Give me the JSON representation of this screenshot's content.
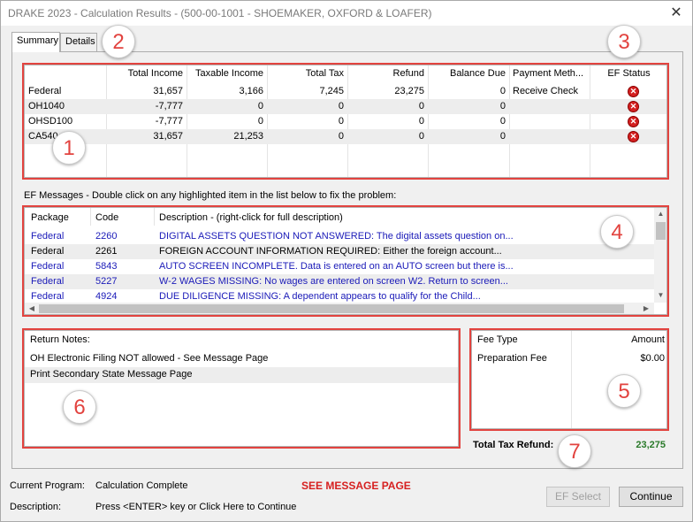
{
  "window": {
    "title": "DRAKE 2023 - Calculation Results - (500-00-1001 - SHOEMAKER, OXFORD & LOAFER)",
    "close_glyph": "✕"
  },
  "tabs": [
    {
      "label": "Summary",
      "active": true
    },
    {
      "label": "Details",
      "active": false
    }
  ],
  "summary": {
    "columns": [
      "",
      "Total Income",
      "Taxable Income",
      "Total Tax",
      "Refund",
      "Balance Due",
      "Payment Meth...",
      "EF Status"
    ],
    "rows": [
      {
        "name": "Federal",
        "total_income": "31,657",
        "taxable_income": "3,166",
        "total_tax": "7,245",
        "refund": "23,275",
        "balance_due": "0",
        "payment": "Receive Check",
        "ef_status": "error-icon"
      },
      {
        "name": "OH1040",
        "total_income": "-7,777",
        "taxable_income": "0",
        "total_tax": "0",
        "refund": "0",
        "balance_due": "0",
        "payment": "",
        "ef_status": "error-icon"
      },
      {
        "name": "OHSD100",
        "total_income": "-7,777",
        "taxable_income": "0",
        "total_tax": "0",
        "refund": "0",
        "balance_due": "0",
        "payment": "",
        "ef_status": "error-icon"
      },
      {
        "name": "CA540",
        "total_income": "31,657",
        "taxable_income": "21,253",
        "total_tax": "0",
        "refund": "0",
        "balance_due": "0",
        "payment": "",
        "ef_status": "error-icon"
      }
    ]
  },
  "ef_messages": {
    "heading": "EF Messages - Double click on any highlighted item in the list below to fix the problem:",
    "columns": [
      "Package",
      "Code",
      "Description - (right-click for full description)"
    ],
    "rows": [
      {
        "package": "Federal",
        "code": "2260",
        "description": "DIGITAL ASSETS QUESTION NOT ANSWERED: The digital assets question on...",
        "highlighted": true
      },
      {
        "package": "Federal",
        "code": "2261",
        "description": "FOREIGN ACCOUNT INFORMATION REQUIRED: Either the foreign account...",
        "highlighted": false
      },
      {
        "package": "Federal",
        "code": "5843",
        "description": "AUTO SCREEN INCOMPLETE. Data is entered on an AUTO screen but there is...",
        "highlighted": true
      },
      {
        "package": "Federal",
        "code": "5227",
        "description": "W-2 WAGES MISSING: No wages are entered on screen W2. Return to screen...",
        "highlighted": true
      },
      {
        "package": "Federal",
        "code": "4924",
        "description": "DUE DILIGENCE MISSING: A dependent appears to qualify for the Child...",
        "highlighted": true
      }
    ]
  },
  "return_notes": {
    "heading": "Return Notes:",
    "items": [
      "OH Electronic Filing NOT allowed - See Message Page",
      "Print Secondary State Message Page"
    ]
  },
  "fees": {
    "columns": [
      "Fee Type",
      "Amount"
    ],
    "rows": [
      {
        "type": "Preparation Fee",
        "amount": "$0.00"
      }
    ]
  },
  "total_refund": {
    "label": "Total Tax Refund:",
    "value": "23,275"
  },
  "status": {
    "current_program_label": "Current Program:",
    "current_program_value": "Calculation Complete",
    "alert": "SEE MESSAGE PAGE",
    "description_label": "Description:",
    "description_value": "Press <ENTER> key or Click Here to Continue"
  },
  "buttons": {
    "ef_select": "EF Select",
    "continue": "Continue"
  },
  "callouts": [
    "1",
    "2",
    "3",
    "4",
    "5",
    "6",
    "7"
  ],
  "colors": {
    "annotation_red": "#e2433f",
    "link_blue": "#1a1ab8",
    "alert_red": "#d62020",
    "refund_green": "#2a7a2a"
  }
}
